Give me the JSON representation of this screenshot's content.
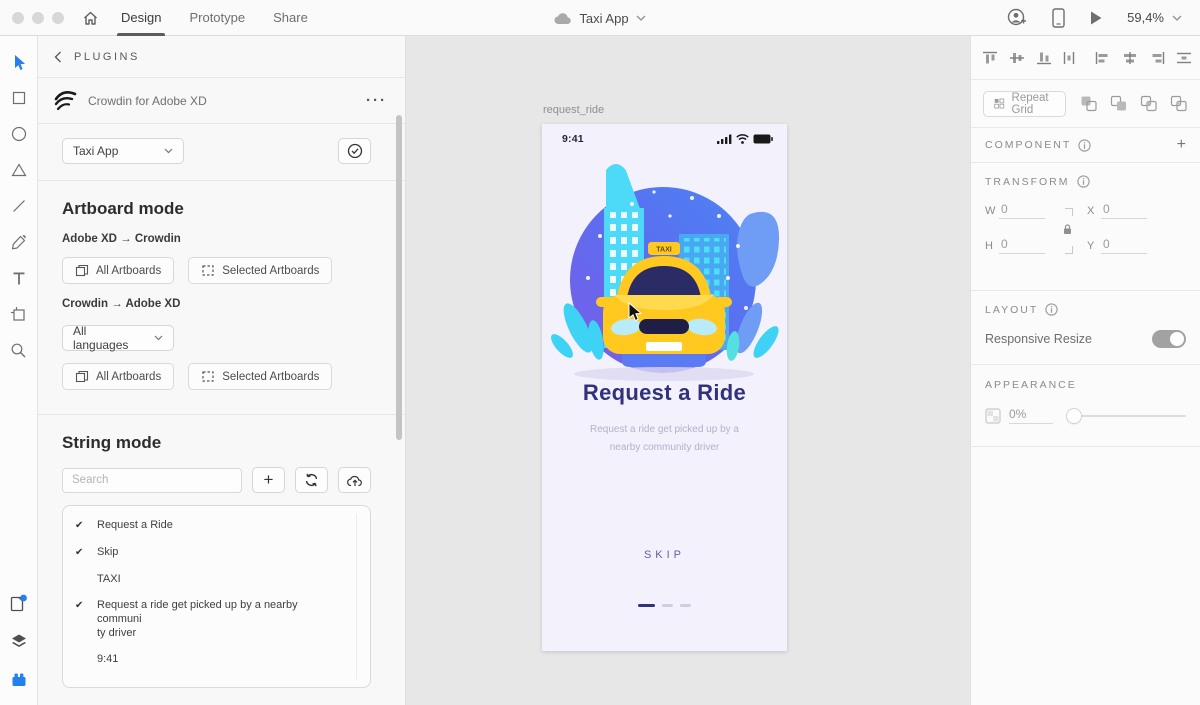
{
  "titlebar": {
    "tab_design": "Design",
    "tab_prototype": "Prototype",
    "tab_share": "Share",
    "doc_title": "Taxi App",
    "zoom_level": "59,4%"
  },
  "icons": {
    "plus": "+",
    "dots": "···",
    "checkmark": "✔"
  },
  "plugin_panel": {
    "header": "PLUGINS",
    "plugin_name": "Crowdin for Adobe XD",
    "project_value": "Taxi App",
    "artboard_mode": {
      "title": "Artboard mode",
      "direction_xd_to_crowdin": "Adobe XD → Crowdin",
      "direction_crowdin_to_xd": "Crowdin → Adobe XD",
      "all_artboards": "All Artboards",
      "selected_artboards": "Selected Artboards",
      "languages_value": "All languages"
    },
    "string_mode": {
      "title": "String mode",
      "search_placeholder": "Search",
      "strings": [
        {
          "check": "✔",
          "text": "Request a Ride"
        },
        {
          "check": "✔",
          "text": "Skip"
        },
        {
          "check": "",
          "text": "TAXI"
        },
        {
          "check": "✔",
          "text": "Request a ride get picked up by a nearby communi",
          "text2": "ty driver"
        },
        {
          "check": "",
          "text": "9:41"
        }
      ]
    }
  },
  "canvas": {
    "artboard_label": "request_ride",
    "phone": {
      "status_time": "9:41",
      "taxi_sign": "TAXI",
      "title": "Request a Ride",
      "subtitle_line1": "Request a ride get picked up by a",
      "subtitle_line2": "nearby community driver",
      "skip_label": "SKIP"
    }
  },
  "right_panel": {
    "repeat_grid_label": "Repeat Grid",
    "component_label": "COMPONENT",
    "transform_label": "TRANSFORM",
    "layout_label": "LAYOUT",
    "appearance_label": "APPEARANCE",
    "responsive_resize_label": "Responsive Resize",
    "opacity_value": "0%",
    "transform": {
      "w_label": "W",
      "h_label": "H",
      "x_label": "X",
      "y_label": "Y",
      "w": "0",
      "h": "0",
      "x": "0",
      "y": "0"
    }
  },
  "colors": {
    "accent_blue": "#2680eb",
    "title_indigo": "#32327c",
    "taxi_yellow": "#ffc91f",
    "canvas_gray": "#e7e7e8"
  }
}
